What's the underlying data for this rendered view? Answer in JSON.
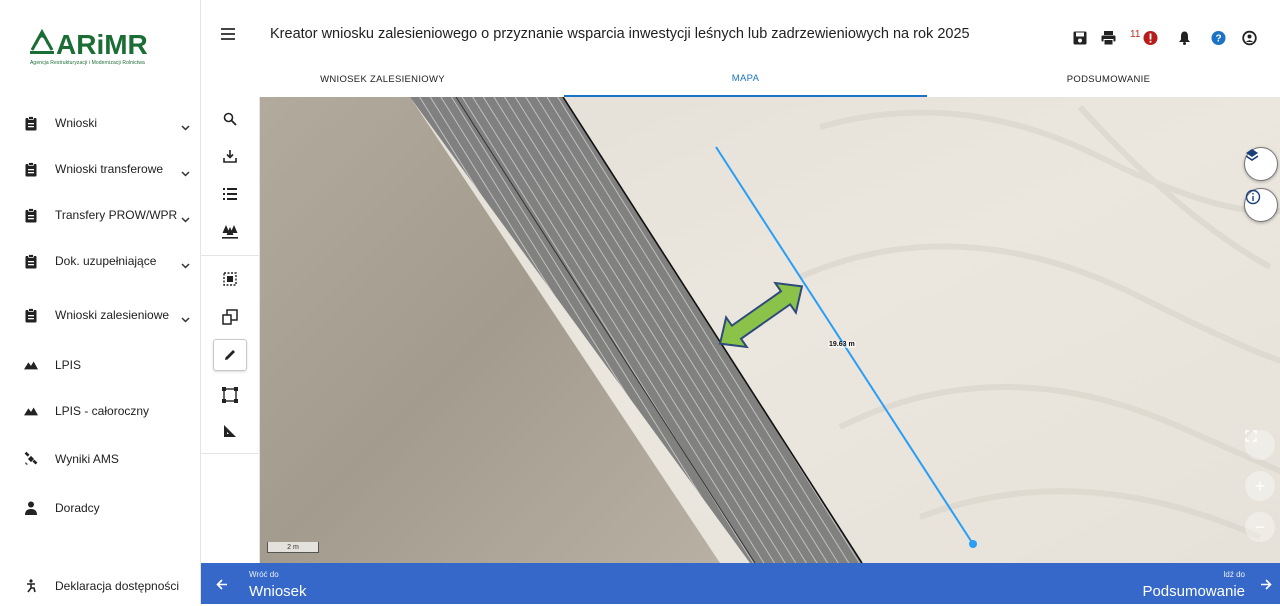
{
  "brand": {
    "name": "ARiMR",
    "tagline": "Agencja Restrukturyzacji i Modernizacji Rolnictwa",
    "color": "#1b6d36"
  },
  "sidebar": {
    "items": [
      {
        "label": "Wnioski",
        "icon": "clipboard-icon",
        "chevron": true
      },
      {
        "label": "Wnioski transferowe",
        "icon": "clipboard-icon",
        "chevron": true
      },
      {
        "label": "Transfery PROW/WPR",
        "icon": "clipboard-icon",
        "chevron": true
      },
      {
        "label": "Dok. uzupełniające",
        "icon": "clipboard-icon",
        "chevron": true
      },
      {
        "label": "Wnioski zalesieniowe",
        "icon": "clipboard-icon",
        "chevron": true
      },
      {
        "label": "LPIS",
        "icon": "terrain-icon",
        "chevron": false
      },
      {
        "label": "LPIS - całoroczny",
        "icon": "terrain-icon",
        "chevron": false
      },
      {
        "label": "Wyniki AMS",
        "icon": "satellite-icon",
        "chevron": false
      },
      {
        "label": "Doradcy",
        "icon": "person-icon",
        "chevron": false
      }
    ],
    "bottom": {
      "label": "Deklaracja dostępności",
      "icon": "accessibility-icon"
    }
  },
  "header": {
    "title": "Kreator wniosku zalesieniowego o przyznanie wsparcia inwestycji leśnych lub zadrzewieniowych na rok 2025",
    "notification_count": "11",
    "tabs": [
      {
        "label": "WNIOSEK ZALESIENIOWY",
        "active": false
      },
      {
        "label": "MAPA",
        "active": true
      },
      {
        "label": "PODSUMOWANIE",
        "active": false
      }
    ]
  },
  "toolbar": {
    "tools": [
      "search-icon",
      "download-icon",
      "list-icon",
      "forest-icon",
      "select-area-icon",
      "copy-shape-icon",
      "draw-icon",
      "rectangle-select-icon",
      "measure-icon"
    ],
    "active_tool": "draw-icon"
  },
  "map": {
    "scale_label": "2 m",
    "measurement_label": "19.63 m"
  },
  "footer": {
    "back_small": "Wróć do",
    "back_big": "Wniosek",
    "forward_small": "Idź do",
    "forward_big": "Podsumowanie"
  },
  "colors": {
    "accent": "#1a73c4",
    "footer": "#3568c9",
    "arrow": "#8bc34a",
    "alert": "#c62828"
  }
}
